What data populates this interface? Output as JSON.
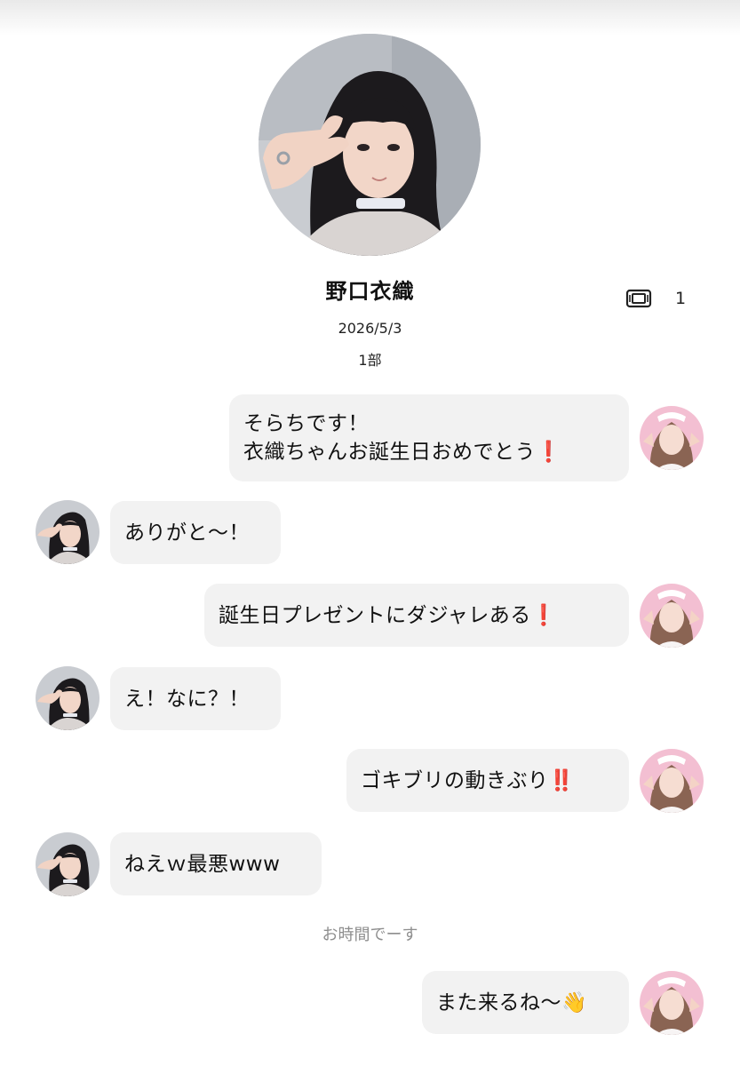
{
  "profile": {
    "name": "野口衣織",
    "date": "2026/5/3",
    "part": "1部",
    "ticket_icon": "ticket-icon",
    "ticket_count": "1"
  },
  "messages": [
    {
      "side": "right",
      "lines": [
        "そらちです！",
        "衣織ちゃんお誕生日おめでとう"
      ],
      "emoji": "❗"
    },
    {
      "side": "left",
      "text": "ありがと〜！"
    },
    {
      "side": "right",
      "text": "誕生日プレゼントにダジャレある",
      "emoji": "❗"
    },
    {
      "side": "left",
      "text": "え！なに？！"
    },
    {
      "side": "right",
      "text": "ゴキブリの動きぶり",
      "emoji": "‼️"
    },
    {
      "side": "left",
      "text": "ねえｗ最悪www"
    },
    {
      "side": "right",
      "text": "また来るね〜",
      "emoji": "👋"
    }
  ],
  "system_note": "お時間でーす",
  "colors": {
    "bubble": "#f2f2f2",
    "accent_red": "#d9261c",
    "note_gray": "#8e8e8e"
  }
}
